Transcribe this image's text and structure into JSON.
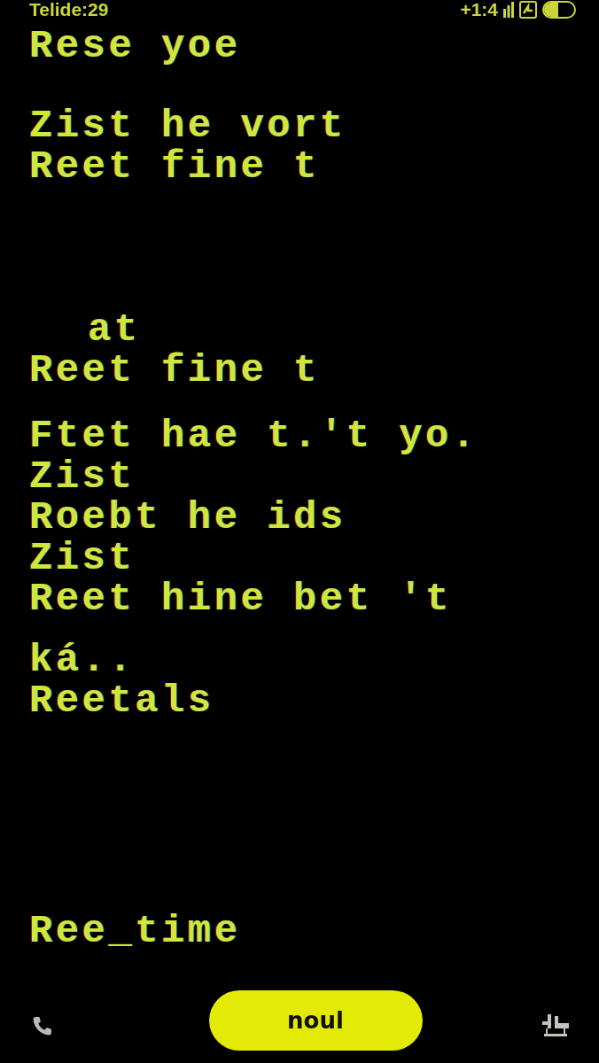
{
  "status_bar": {
    "time": "Telide:29",
    "clock": "+1:4"
  },
  "blocks": [
    {
      "lines": [
        {
          "text": "Rese yoe",
          "kind": "line"
        }
      ]
    },
    {
      "lines": [
        {
          "text": "Zist he vort",
          "kind": "line"
        },
        {
          "text": "Reet fine t",
          "kind": "line"
        }
      ]
    },
    {
      "lines": [
        {
          "text": "at",
          "kind": "indented"
        },
        {
          "text": "Reet fine t",
          "kind": "line"
        }
      ]
    },
    {
      "lines": [
        {
          "text": "Ftet hae t.'t yo.",
          "kind": "line"
        },
        {
          "text": "Zist",
          "kind": "line"
        },
        {
          "text": "Roebt he ids",
          "kind": "line"
        },
        {
          "text": "Zist",
          "kind": "line"
        },
        {
          "text": "Reet hine bet 't",
          "kind": "line"
        }
      ]
    },
    {
      "lines": [
        {
          "text": "ká..",
          "kind": "line"
        },
        {
          "text": "Reetals",
          "kind": "line"
        }
      ]
    },
    {
      "lines": [
        {
          "text": "Ree_time",
          "kind": "line"
        }
      ]
    }
  ],
  "bottom_bar": {
    "button": "noul"
  }
}
